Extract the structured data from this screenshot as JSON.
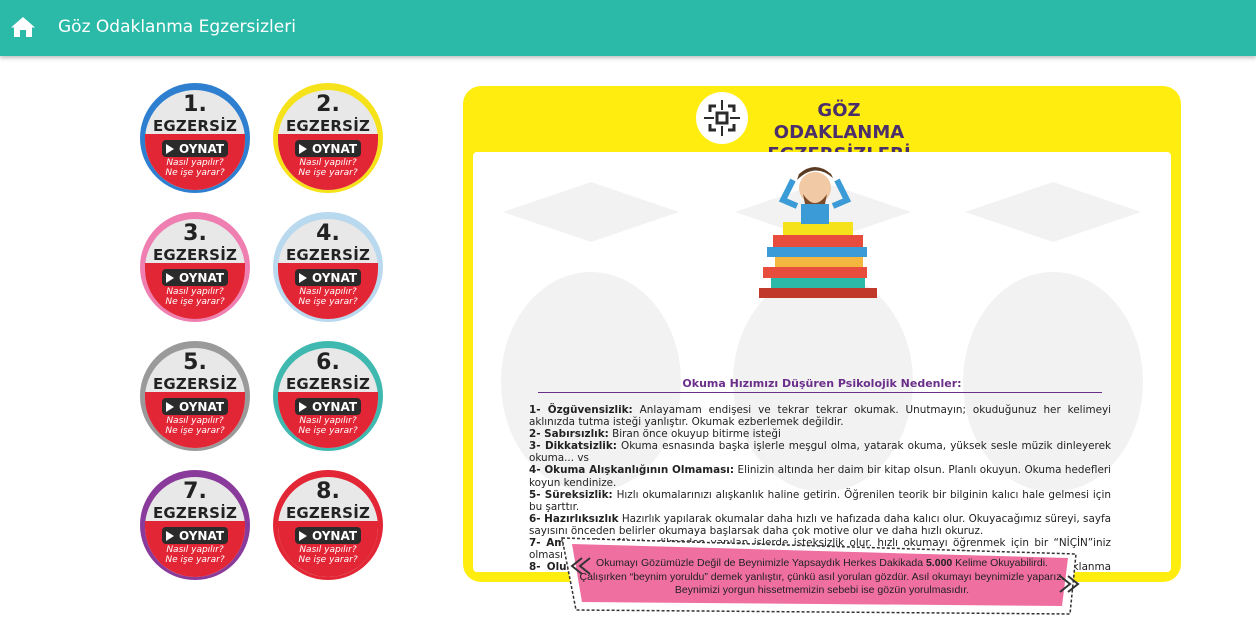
{
  "header": {
    "title": "Göz Odaklanma Egzersizleri",
    "home_icon": "home-icon"
  },
  "colors": {
    "topbar": "#2bb9a8",
    "panel": "#ffed0f",
    "accent_red": "#e32636",
    "title_purple": "#4a2f6b"
  },
  "exercises": [
    {
      "number": "1.",
      "label": "EGZERSİZ",
      "play": "OYNAT",
      "how1": "Nasıl yapılır?",
      "how2": "Ne işe yarar?",
      "ring": "#2f7fd1"
    },
    {
      "number": "2.",
      "label": "EGZERSİZ",
      "play": "OYNAT",
      "how1": "Nasıl yapılır?",
      "how2": "Ne işe yarar?",
      "ring": "#f6e21a"
    },
    {
      "number": "3.",
      "label": "EGZERSİZ",
      "play": "OYNAT",
      "how1": "Nasıl yapılır?",
      "how2": "Ne işe yarar?",
      "ring": "#ef7fb1"
    },
    {
      "number": "4.",
      "label": "EGZERSİZ",
      "play": "OYNAT",
      "how1": "Nasıl yapılır?",
      "how2": "Ne işe yarar?",
      "ring": "#b9d9ef"
    },
    {
      "number": "5.",
      "label": "EGZERSİZ",
      "play": "OYNAT",
      "how1": "Nasıl yapılır?",
      "how2": "Ne işe yarar?",
      "ring": "#9a9a9a"
    },
    {
      "number": "6.",
      "label": "EGZERSİZ",
      "play": "OYNAT",
      "how1": "Nasıl yapılır?",
      "how2": "Ne işe yarar?",
      "ring": "#3fb9b0"
    },
    {
      "number": "7.",
      "label": "EGZERSİZ",
      "play": "OYNAT",
      "how1": "Nasıl yapılır?",
      "how2": "Ne işe yarar?",
      "ring": "#8a3a9a"
    },
    {
      "number": "8.",
      "label": "EGZERSİZ",
      "play": "OYNAT",
      "how1": "Nasıl yapılır?",
      "how2": "Ne işe yarar?",
      "ring": "#e32636"
    }
  ],
  "panel": {
    "title_line1": "GÖZ ODAKLANMA",
    "title_line2": "EGZERSİZLERİ",
    "subtitle": "Okuma Hızımızı Düşüren Psikolojik Nedenler:",
    "reasons": [
      {
        "head": "1- Özgüvensizlik:",
        "body": " Anlayamam endişesi ve tekrar tekrar okumak. Unutmayın; okuduğunuz her kelimeyi aklınızda tutma isteği yanlıştır. Okumak ezberlemek değildir."
      },
      {
        "head": "2- Sabırsızlık:",
        "body": " Biran önce okuyup bitirme isteği"
      },
      {
        "head": "3- Dikkatsizlik:",
        "body": " Okuma esnasında başka işlerle meşgul olma, yatarak okuma, yüksek sesle müzik dinleyerek okuma... vs"
      },
      {
        "head": "4- Okuma Alışkanlığının Olmaması:",
        "body": " Elinizin altında her daim bir kitap olsun. Planlı okuyun. Okuma hedefleri koyun kendinize."
      },
      {
        "head": "5- Süreksizlik:",
        "body": " Hızlı okumalarınızı alışkanlık haline getirin. Öğrenilen teorik bir bilginin kalıcı hale gelmesi için bu şarttır."
      },
      {
        "head": "6- Hazırlıksızlık",
        "body": " Hazırlık yapılarak okumalar daha hızlı ve hafızada daha kalıcı olur. Okuyacağımız süreyi, sayfa sayısını önceden belirler okumaya başlarsak daha çok motive olur ve daha hızlı okuruz."
      },
      {
        "head": "7- Amaçsızlık:",
        "body": " Niyet edilmeden yapılan işlerde isteksizlik olur. hızlı okumayı öğrenmek için bir “NİÇİN”iniz olması gerek, eğer bu yoksa “okuyorum okuyorum anlamıyorum” durumuna düşersiniz."
      },
      {
        "head": "8- Olumsuz Duygu Durumları:",
        "body": " Stres, korku, endişe, depresyon gibi olumsuz durumlar sizde odaklanma sorunu yaşatacağından hızlı okumanızı engeller."
      }
    ]
  },
  "banner": {
    "line1a": "Okumayı Gözümüzle Değil de Beynimizle Yapsaydık Herkes Dakikada ",
    "line1b": "5.000",
    "line1c": " Kelime Okuyabilirdi.",
    "line2": "Çalışırken “beynim yoruldu” demek yanlıştır, çünkü asıl yorulan gözdür. Asıl okumayı beynimizle yaparız.",
    "line3": "Beynimizi yorgun hissetmemizin sebebi ise gözün yorulmasıdır."
  }
}
